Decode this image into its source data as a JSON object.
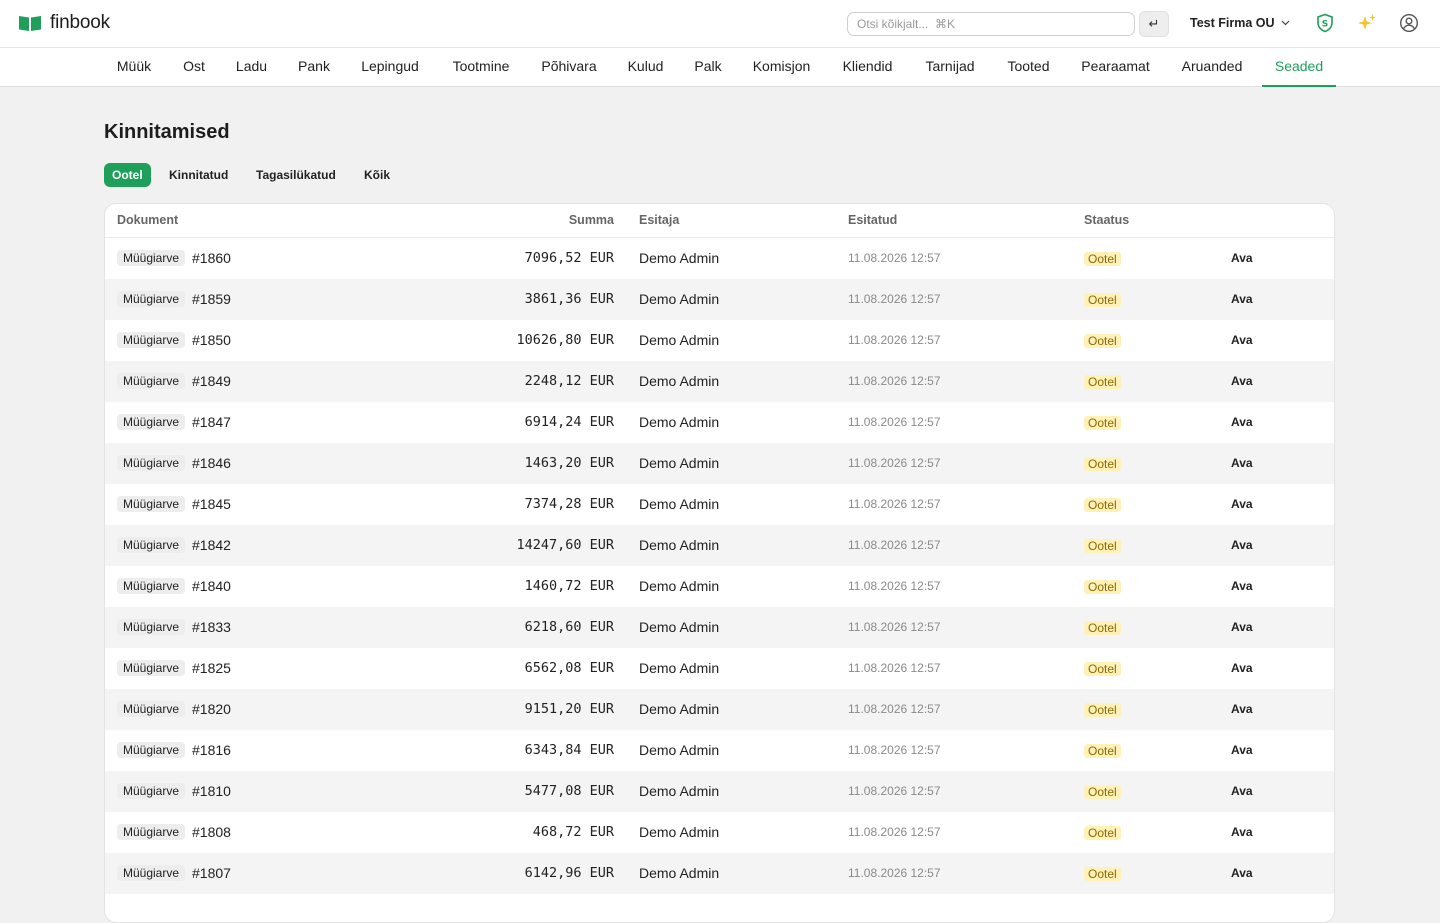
{
  "app": {
    "name": "finbook"
  },
  "header": {
    "search_placeholder": "Otsi kõikjalt...  ⌘K",
    "enter_symbol": "↵",
    "company": "Test Firma OU"
  },
  "nav": [
    "Müük",
    "Ost",
    "Ladu",
    "Pank",
    "Lepingud",
    "Tootmine",
    "Põhivara",
    "Kulud",
    "Palk",
    "Komisjon",
    "Kliendid",
    "Tarnijad",
    "Tooted",
    "Pearaamat",
    "Aruanded",
    "Seaded"
  ],
  "nav_active": "Seaded",
  "page": {
    "title": "Kinnitamised"
  },
  "filters": [
    "Ootel",
    "Kinnitatud",
    "Tagasilükatud",
    "Kõik"
  ],
  "filter_active": "Ootel",
  "table": {
    "headers": {
      "document": "Dokument",
      "amount": "Summa",
      "submitter": "Esitaja",
      "submitted": "Esitatud",
      "status": "Staatus"
    },
    "rows": [
      {
        "type": "Müügiarve",
        "number": "#1860",
        "amount": "7096,52 EUR",
        "submitter": "Demo Admin",
        "date": "11.08.2026 12:57",
        "status": "Ootel",
        "action": "Ava"
      },
      {
        "type": "Müügiarve",
        "number": "#1859",
        "amount": "3861,36 EUR",
        "submitter": "Demo Admin",
        "date": "11.08.2026 12:57",
        "status": "Ootel",
        "action": "Ava"
      },
      {
        "type": "Müügiarve",
        "number": "#1850",
        "amount": "10626,80 EUR",
        "submitter": "Demo Admin",
        "date": "11.08.2026 12:57",
        "status": "Ootel",
        "action": "Ava"
      },
      {
        "type": "Müügiarve",
        "number": "#1849",
        "amount": "2248,12 EUR",
        "submitter": "Demo Admin",
        "date": "11.08.2026 12:57",
        "status": "Ootel",
        "action": "Ava"
      },
      {
        "type": "Müügiarve",
        "number": "#1847",
        "amount": "6914,24 EUR",
        "submitter": "Demo Admin",
        "date": "11.08.2026 12:57",
        "status": "Ootel",
        "action": "Ava"
      },
      {
        "type": "Müügiarve",
        "number": "#1846",
        "amount": "1463,20 EUR",
        "submitter": "Demo Admin",
        "date": "11.08.2026 12:57",
        "status": "Ootel",
        "action": "Ava"
      },
      {
        "type": "Müügiarve",
        "number": "#1845",
        "amount": "7374,28 EUR",
        "submitter": "Demo Admin",
        "date": "11.08.2026 12:57",
        "status": "Ootel",
        "action": "Ava"
      },
      {
        "type": "Müügiarve",
        "number": "#1842",
        "amount": "14247,60 EUR",
        "submitter": "Demo Admin",
        "date": "11.08.2026 12:57",
        "status": "Ootel",
        "action": "Ava"
      },
      {
        "type": "Müügiarve",
        "number": "#1840",
        "amount": "1460,72 EUR",
        "submitter": "Demo Admin",
        "date": "11.08.2026 12:57",
        "status": "Ootel",
        "action": "Ava"
      },
      {
        "type": "Müügiarve",
        "number": "#1833",
        "amount": "6218,60 EUR",
        "submitter": "Demo Admin",
        "date": "11.08.2026 12:57",
        "status": "Ootel",
        "action": "Ava"
      },
      {
        "type": "Müügiarve",
        "number": "#1825",
        "amount": "6562,08 EUR",
        "submitter": "Demo Admin",
        "date": "11.08.2026 12:57",
        "status": "Ootel",
        "action": "Ava"
      },
      {
        "type": "Müügiarve",
        "number": "#1820",
        "amount": "9151,20 EUR",
        "submitter": "Demo Admin",
        "date": "11.08.2026 12:57",
        "status": "Ootel",
        "action": "Ava"
      },
      {
        "type": "Müügiarve",
        "number": "#1816",
        "amount": "6343,84 EUR",
        "submitter": "Demo Admin",
        "date": "11.08.2026 12:57",
        "status": "Ootel",
        "action": "Ava"
      },
      {
        "type": "Müügiarve",
        "number": "#1810",
        "amount": "5477,08 EUR",
        "submitter": "Demo Admin",
        "date": "11.08.2026 12:57",
        "status": "Ootel",
        "action": "Ava"
      },
      {
        "type": "Müügiarve",
        "number": "#1808",
        "amount": "468,72 EUR",
        "submitter": "Demo Admin",
        "date": "11.08.2026 12:57",
        "status": "Ootel",
        "action": "Ava"
      },
      {
        "type": "Müügiarve",
        "number": "#1807",
        "amount": "6142,96 EUR",
        "submitter": "Demo Admin",
        "date": "11.08.2026 12:57",
        "status": "Ootel",
        "action": "Ava"
      }
    ]
  },
  "icons": {
    "logo": "book-icon",
    "security": "shield-icon",
    "ai": "sparkles-icon",
    "account": "user-circle-icon",
    "company_menu": "chevron-down-icon"
  },
  "colors": {
    "brand": "#1fa05a",
    "status_pending_bg": "#fff1b8",
    "status_pending_text": "#8a6a00",
    "sparkle": "#f2c230"
  }
}
